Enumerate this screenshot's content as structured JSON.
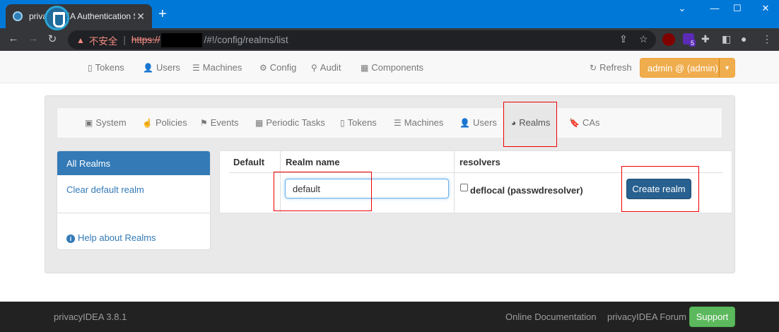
{
  "browser": {
    "tab_title": "privacyIDEA Authentication Sy",
    "tab_close": "✕",
    "new_tab": "+",
    "url_insecure_label": "不安全",
    "url_scheme": "https://",
    "url_path": "/#!/config/realms/list",
    "extension_badge": "5"
  },
  "navbar": {
    "items": [
      {
        "label": "Tokens",
        "icon": "mobile-icon"
      },
      {
        "label": "Users",
        "icon": "user-icon"
      },
      {
        "label": "Machines",
        "icon": "server-icon"
      },
      {
        "label": "Config",
        "icon": "gear-icon"
      },
      {
        "label": "Audit",
        "icon": "search-icon"
      },
      {
        "label": "Components",
        "icon": "table-icon"
      }
    ],
    "refresh": "Refresh",
    "admin": "admin @ (admin)"
  },
  "config_tabs": [
    {
      "label": "System",
      "icon": "briefcase-icon"
    },
    {
      "label": "Policies",
      "icon": "hand-icon"
    },
    {
      "label": "Events",
      "icon": "flag-icon"
    },
    {
      "label": "Periodic Tasks",
      "icon": "calendar-icon"
    },
    {
      "label": "Tokens",
      "icon": "mobile-icon"
    },
    {
      "label": "Machines",
      "icon": "server-icon"
    },
    {
      "label": "Users",
      "icon": "user-icon"
    },
    {
      "label": "Realms",
      "icon": "globe-icon",
      "active": true
    },
    {
      "label": "CAs",
      "icon": "bookmark-icon"
    }
  ],
  "sidebar": {
    "all_realms": "All Realms",
    "clear_default": "Clear default realm",
    "help": "Help about Realms"
  },
  "realm_table": {
    "headers": {
      "default": "Default",
      "realm_name": "Realm name",
      "resolvers": "resolvers"
    },
    "realm_name_value": "default",
    "resolver": "deflocal (passwdresolver)",
    "resolver_checked": false,
    "create_button": "Create realm"
  },
  "footer": {
    "version": "privacyIDEA 3.8.1",
    "docs": "Online Documentation",
    "forum": "privacyIDEA Forum",
    "support": "Support"
  },
  "colors": {
    "accent": "#337ab7",
    "admin_button": "#f0ad4e",
    "primary_button": "#286090",
    "support_button": "#5cb85c",
    "annotation": "#ee0000"
  }
}
